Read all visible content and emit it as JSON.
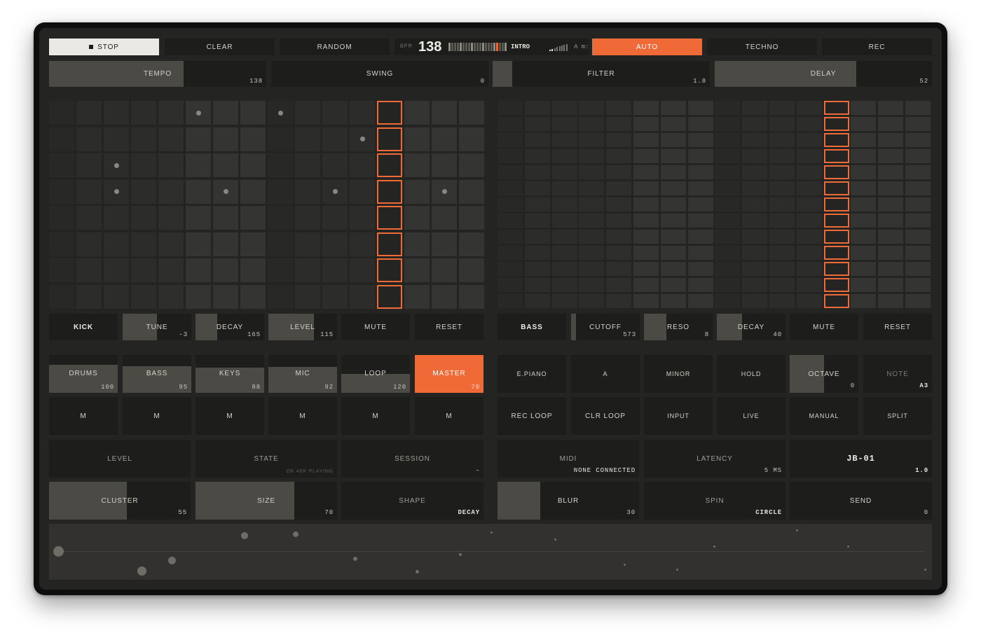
{
  "transport": {
    "stop": "STOP",
    "clear": "CLEAR",
    "random": "RANDOM",
    "bpm_label": "BPM",
    "bpm_value": "138",
    "section": "INTRO",
    "key": "A m:",
    "auto": "AUTO",
    "style": "TECHNO",
    "rec": "REC"
  },
  "params_row": [
    {
      "label": "TEMPO",
      "value": "138",
      "fill": 0.62
    },
    {
      "label": "SWING",
      "value": "0",
      "fill": 0
    },
    {
      "label": "FILTER",
      "value": "1.8",
      "fill": 0.09
    },
    {
      "label": "DELAY",
      "value": "52",
      "fill": 0.65
    }
  ],
  "drums": {
    "playhead_step": 12,
    "active_steps": [
      [
        5,
        0
      ],
      [
        8,
        0
      ],
      [
        11,
        1
      ],
      [
        2,
        2
      ],
      [
        2,
        3
      ],
      [
        6,
        3
      ],
      [
        10,
        3
      ],
      [
        14,
        3
      ]
    ],
    "controls": [
      {
        "label": "KICK",
        "value": "",
        "fill": 0,
        "bold": true
      },
      {
        "label": "TUNE",
        "value": "-3",
        "fill": 0.5
      },
      {
        "label": "DECAY",
        "value": "165",
        "fill": 0.32
      },
      {
        "label": "LEVEL",
        "value": "115",
        "fill": 0.66
      },
      {
        "label": "MUTE",
        "value": "",
        "fill": 0
      },
      {
        "label": "RESET",
        "value": "",
        "fill": 0
      }
    ]
  },
  "bass": {
    "playhead_step": 12,
    "controls": [
      {
        "label": "BASS",
        "value": "",
        "fill": 0,
        "bold": true
      },
      {
        "label": "CUTOFF",
        "value": "573",
        "fill": 0.07
      },
      {
        "label": "RESO",
        "value": "8",
        "fill": 0.33
      },
      {
        "label": "DECAY",
        "value": "40",
        "fill": 0.37
      },
      {
        "label": "MUTE",
        "value": "",
        "fill": 0
      },
      {
        "label": "RESET",
        "value": "",
        "fill": 0
      }
    ]
  },
  "mixer": {
    "channels": [
      {
        "label": "DRUMS",
        "value": "100",
        "level": 0.75
      },
      {
        "label": "BASS",
        "value": "95",
        "level": 0.71
      },
      {
        "label": "KEYS",
        "value": "88",
        "level": 0.66
      },
      {
        "label": "MIC",
        "value": "92",
        "level": 0.69
      },
      {
        "label": "LOOP",
        "value": "120",
        "level": 0.5
      },
      {
        "label": "MASTER",
        "value": "70",
        "level": 1.0,
        "accent": true
      }
    ],
    "mute_label": "M"
  },
  "keys_panel": {
    "row1": [
      {
        "label": "E.PIANO",
        "value": ""
      },
      {
        "label": "A",
        "value": ""
      },
      {
        "label": "MINOR",
        "value": ""
      },
      {
        "label": "HOLD",
        "value": ""
      },
      {
        "label": "OCTAVE",
        "value": "0",
        "fill": 0.5
      },
      {
        "label": "NOTE",
        "value": "A3",
        "dim": true
      }
    ],
    "row2": [
      "REC LOOP",
      "CLR LOOP",
      "INPUT",
      "LIVE",
      "MANUAL",
      "SPLIT"
    ]
  },
  "status": {
    "level": "LEVEL",
    "state": "STATE",
    "state_value": "OK 48K PLAYING",
    "session": "SESSION",
    "session_value": "–",
    "midi": "MIDI",
    "midi_value": "none connected",
    "latency": "LATENCY",
    "latency_value": "5 ms",
    "device": "JB-01",
    "version": "1.0"
  },
  "fx": [
    {
      "label": "CLUSTER",
      "value": "55",
      "fill": 0.55
    },
    {
      "label": "SIZE",
      "value": "70",
      "fill": 0.7
    },
    {
      "label": "SHAPE",
      "value": "DECAY",
      "fill": 0
    },
    {
      "label": "BLUR",
      "value": "30",
      "fill": 0.3
    },
    {
      "label": "SPIN",
      "value": "CIRCLE",
      "fill": 0
    },
    {
      "label": "SEND",
      "value": "0",
      "fill": 0
    }
  ],
  "colors": {
    "accent": "#ef6a37",
    "panel": "#1d1d1b",
    "screen": "#242422",
    "fill": "#4b4a45"
  }
}
